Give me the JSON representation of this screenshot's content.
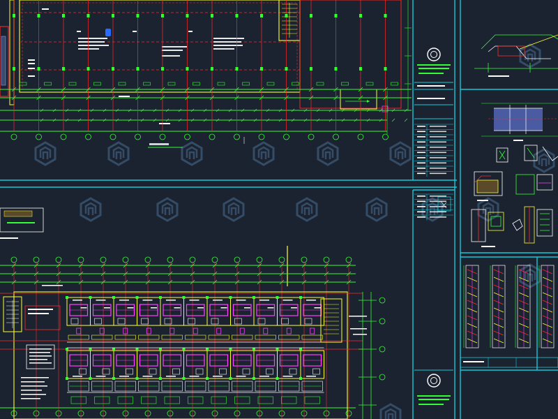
{
  "drawing": {
    "background": "#1b2330",
    "colors": {
      "sheet_border": "#17c8d6",
      "frame": "#ff2a2a",
      "dim": "#33ff33",
      "wall": "#ffff33",
      "room": "#ff40ff",
      "white": "#ffffff",
      "watermark": "#4b6f95",
      "glazing": "#7f9bff"
    },
    "watermark_icon": "hexagon-logo-watermark",
    "title_block_icon": "company-seal-logo",
    "top_plan": {
      "axis_count": 16
    },
    "bottom_plan": {
      "bays": 11,
      "room_rows": 2
    },
    "side_details": [
      "section-detail",
      "node-detail",
      "wall-detail",
      "stair-detail"
    ]
  }
}
